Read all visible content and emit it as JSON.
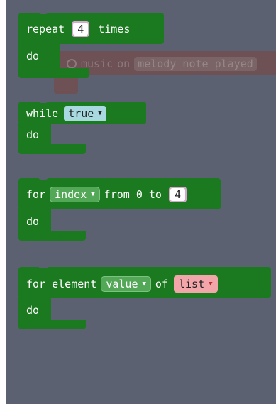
{
  "ghost_block": {
    "text_music": "music",
    "text_on": "on",
    "text_event": "melody note played"
  },
  "repeat_block": {
    "keyword_repeat": "repeat",
    "count": "4",
    "keyword_times": "times",
    "keyword_do": "do"
  },
  "while_block": {
    "keyword_while": "while",
    "condition": "true",
    "keyword_do": "do"
  },
  "for_block": {
    "keyword_for": "for",
    "variable": "index",
    "keyword_from": "from 0 to",
    "upper": "4",
    "keyword_do": "do"
  },
  "foreach_block": {
    "keyword_for": "for element",
    "variable": "value",
    "keyword_of": "of",
    "list": "list",
    "keyword_do": "do"
  },
  "colors": {
    "flyout_bg": "#5b6170",
    "loop_green": "#1b7a1f",
    "number_purple": "#d6a7cf",
    "boolean_blue": "#a8d8e0",
    "list_red": "#f2a6a9",
    "variable_green": "#53a857"
  },
  "icons": {
    "dropdown": "caret-down"
  }
}
